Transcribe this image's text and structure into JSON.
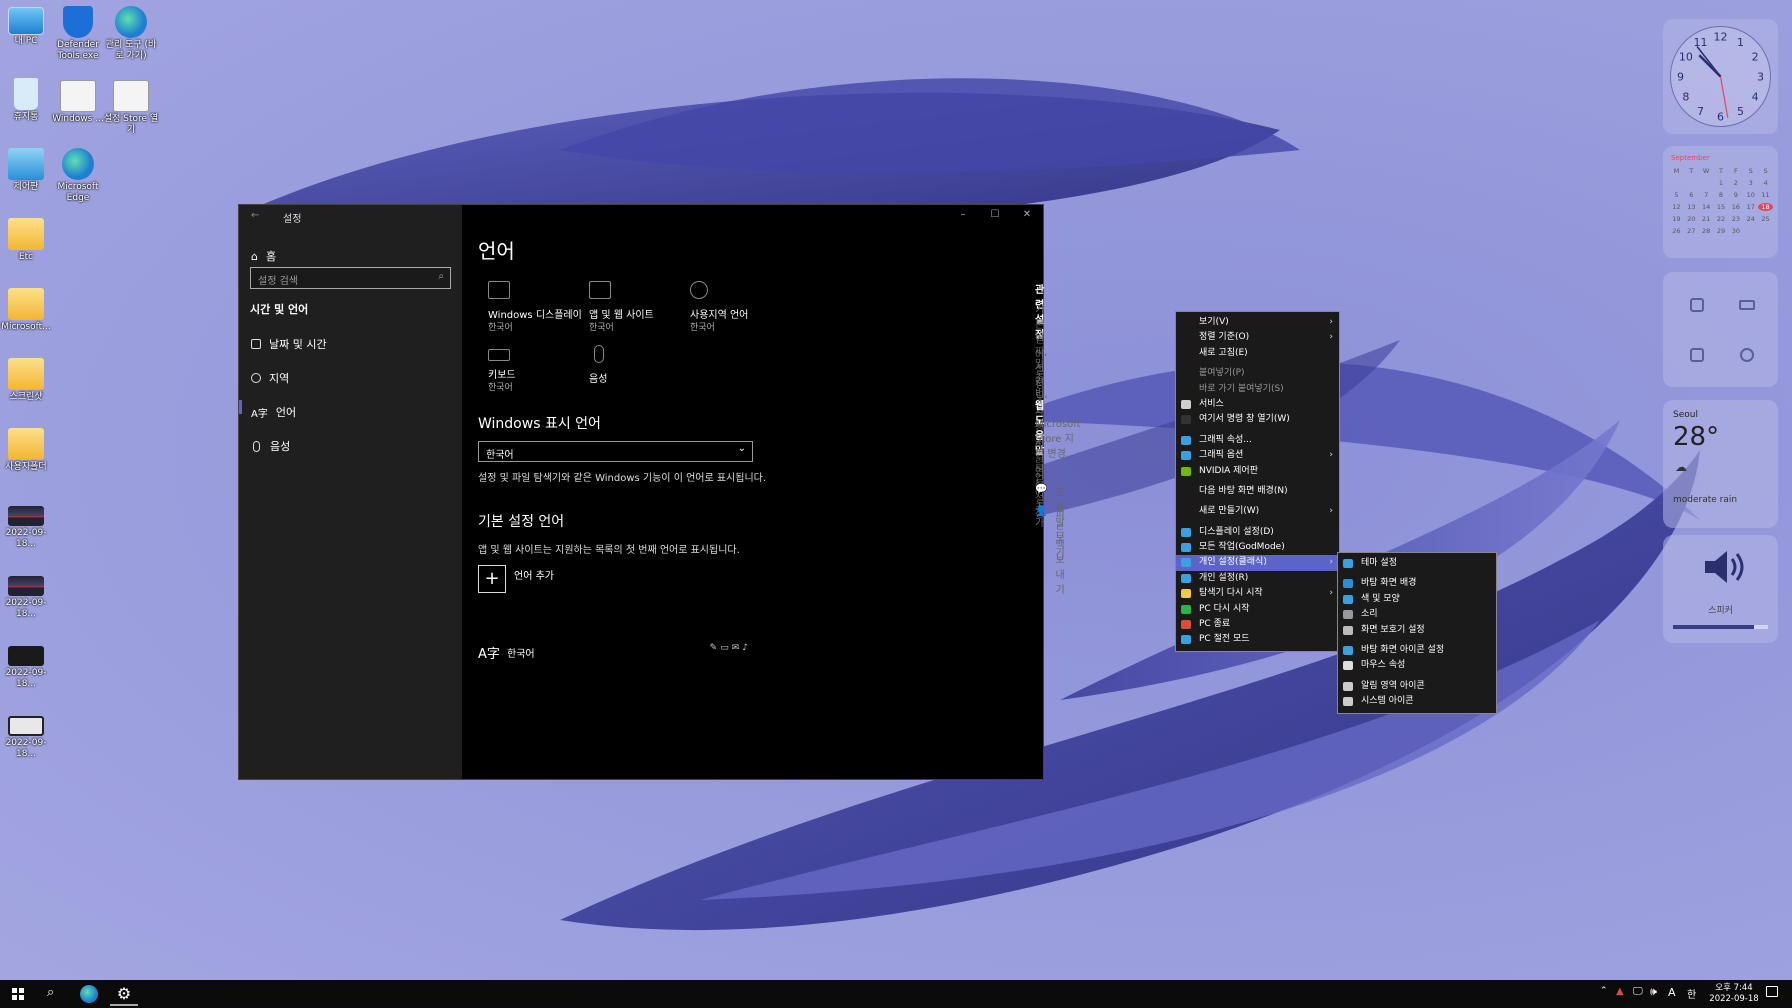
{
  "desktop": {
    "icons": [
      {
        "label": "내 PC",
        "color": "#3aa0e0"
      },
      {
        "label": "Defender Tools.exe",
        "color": "#1c6fd6"
      },
      {
        "label": "관리 도구 (바로 가기)",
        "color": "#2a8fd8"
      },
      {
        "label": "휴지통",
        "color": "#d0e8f8"
      },
      {
        "label": "Windows ...",
        "color": "#eeeeee"
      },
      {
        "label": "설정 Store 열기",
        "color": "#eeeeee"
      },
      {
        "label": "제어판",
        "color": "#3aa0e0"
      },
      {
        "label": "Microsoft Edge",
        "color": "#2a8fd8"
      },
      {
        "label": "Etc",
        "color": "#f2c94c"
      },
      {
        "label": "Microsoft...",
        "color": "#f2c94c"
      },
      {
        "label": "스크린샷",
        "color": "#f2c94c"
      },
      {
        "label": "사용자폴더",
        "color": "#f2c94c"
      },
      {
        "label": "2022-09-18...",
        "color": "#223"
      },
      {
        "label": "2022-09-18...",
        "color": "#223"
      },
      {
        "label": "2022-09-18...",
        "color": "#222"
      },
      {
        "label": "2022-09-18...",
        "color": "#ddd"
      }
    ]
  },
  "settings": {
    "title": "설정",
    "home": "홈",
    "search_placeholder": "설정 검색",
    "section": "시간 및 언어",
    "nav": [
      "날짜 및 시간",
      "지역",
      "언어",
      "음성"
    ],
    "page_title": "언어",
    "tiles": [
      {
        "label": "Windows 디스플레이",
        "sub": "한국어"
      },
      {
        "label": "앱 및 웹 사이트",
        "sub": "한국어"
      },
      {
        "label": "사용지역 언어",
        "sub": "한국어"
      },
      {
        "label": "키보드",
        "sub": "한국어"
      },
      {
        "label": "음성",
        "sub": ""
      }
    ],
    "display_lang_heading": "Windows 표시 언어",
    "display_lang_value": "한국어",
    "display_lang_desc": "설정 및 파일 탐색기와 같은 Windows 기능이 이 언어로 표시됩니다.",
    "pref_heading": "기본 설정 언어",
    "pref_desc": "앱 및 웹 사이트는 지원하는 목록의 첫 번째 언어로 표시됩니다.",
    "add_lang": "언어 추가",
    "lang_item": "한국어",
    "related": {
      "heading": "관련 설정",
      "links": [
        "기본 언어 설정",
        "날짜, 시간 및 사용지역 언어",
        "맞춤법, 입력 및 키보드 설정"
      ]
    },
    "help": {
      "heading": "웹 도움말",
      "links": [
        "Microsoft Store 지역 변경",
        "입력 언어 추가"
      ]
    },
    "extra": [
      "도움말 보기",
      "피드백 보내기"
    ]
  },
  "context_menu": {
    "items": [
      {
        "label": "보기(V)",
        "arrow": true
      },
      {
        "label": "정렬 기준(O)",
        "arrow": true
      },
      {
        "label": "새로 고침(E)"
      },
      {
        "sep": true
      },
      {
        "label": "붙여넣기(P)",
        "disabled": true
      },
      {
        "label": "바로 가기 붙여넣기(S)",
        "disabled": true
      },
      {
        "label": "서비스",
        "icon": "#cfcfcf"
      },
      {
        "label": "여기서 명령 창 열기(W)",
        "icon": "#333"
      },
      {
        "sep": true
      },
      {
        "label": "그래픽 속성...",
        "icon": "#3aa0e0"
      },
      {
        "label": "그래픽 옵션",
        "icon": "#3aa0e0",
        "arrow": true
      },
      {
        "label": "NVIDIA 제어판",
        "icon": "#76b900"
      },
      {
        "sep": true
      },
      {
        "label": "다음 바탕 화면 배경(N)"
      },
      {
        "sep": true
      },
      {
        "label": "새로 만들기(W)",
        "arrow": true
      },
      {
        "sep": true
      },
      {
        "label": "디스플레이 설정(D)",
        "icon": "#3aa0e0"
      },
      {
        "label": "모든 작업(GodMode)",
        "icon": "#3aa0e0"
      },
      {
        "label": "개인 설정(클래식)",
        "icon": "#3aa0e0",
        "arrow": true,
        "highlight": true
      },
      {
        "label": "개인 설정(R)",
        "icon": "#3aa0e0"
      },
      {
        "label": "탐색기 다시 시작",
        "icon": "#f2c94c",
        "arrow": true
      },
      {
        "label": "PC 다시 시작",
        "icon": "#2db34a"
      },
      {
        "label": "PC 종료",
        "icon": "#e04a3a"
      },
      {
        "label": "PC 절전 모드",
        "icon": "#3aa0e0"
      }
    ]
  },
  "submenu": {
    "items": [
      {
        "label": "테마 설정",
        "icon": "#3aa0e0"
      },
      {
        "sep": true
      },
      {
        "label": "바탕 화면 배경",
        "icon": "#2a8fd8"
      },
      {
        "label": "색 및 모양",
        "icon": "#3aa0e0"
      },
      {
        "label": "소리",
        "icon": "#999"
      },
      {
        "label": "화면 보호기 설정",
        "icon": "#bbb"
      },
      {
        "sep": true
      },
      {
        "label": "바탕 화면 아이콘 설정",
        "icon": "#3aa0e0"
      },
      {
        "label": "마우스 속성",
        "icon": "#ddd"
      },
      {
        "sep": true
      },
      {
        "label": "알림 영역 아이콘",
        "icon": "#ccc"
      },
      {
        "label": "시스템 아이콘",
        "icon": "#ccc"
      }
    ]
  },
  "widgets": {
    "clock_numbers": [
      "12",
      "1",
      "2",
      "3",
      "4",
      "5",
      "6",
      "7",
      "8",
      "9",
      "10",
      "11"
    ],
    "calendar": {
      "month": "September",
      "days": [
        "M",
        "T",
        "W",
        "T",
        "F",
        "S",
        "S"
      ],
      "dates": [
        "",
        "",
        "",
        "1",
        "2",
        "3",
        "4",
        "5",
        "6",
        "7",
        "8",
        "9",
        "10",
        "11",
        "12",
        "13",
        "14",
        "15",
        "16",
        "17",
        "18",
        "19",
        "20",
        "21",
        "22",
        "23",
        "24",
        "25",
        "26",
        "27",
        "28",
        "29",
        "30",
        "",
        ""
      ],
      "today": "18"
    },
    "weather": {
      "city": "Seoul",
      "temp": "28°",
      "desc": "moderate rain"
    },
    "speaker": {
      "label": "스피커",
      "volume": 0.85
    }
  },
  "taskbar": {
    "time": "오후 7:44",
    "date": "2022-09-18",
    "ime": "A",
    "ime2": "한"
  }
}
